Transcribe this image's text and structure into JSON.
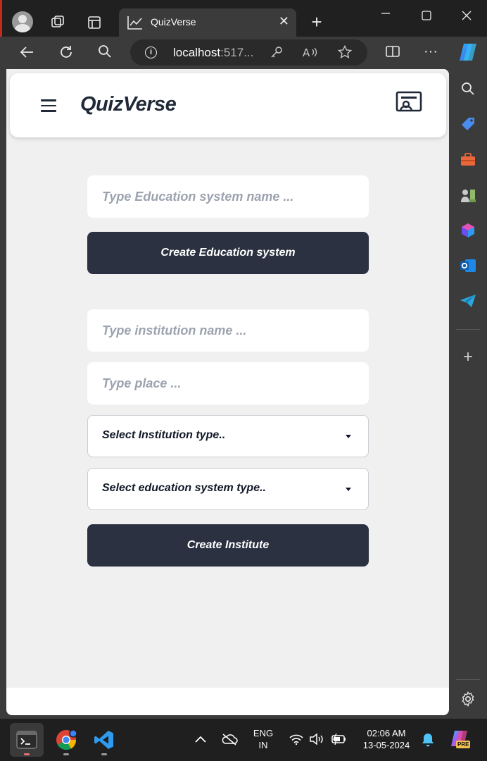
{
  "browser": {
    "tab_title": "QuizVerse",
    "url_host": "localhost",
    "url_rest": ":517...",
    "tab_close": "✕"
  },
  "app": {
    "brand": "QuizVerse"
  },
  "education_form": {
    "name_placeholder": "Type Education system name ...",
    "create_button": "Create Education system"
  },
  "institute_form": {
    "name_placeholder": "Type institution name ...",
    "place_placeholder": "Type place ...",
    "institution_type_select": "Select Institution type..",
    "education_system_select": "Select education system type..",
    "create_button": "Create Institute"
  },
  "taskbar": {
    "language_line1": "ENG",
    "language_line2": "IN",
    "time": "02:06 AM",
    "date": "13-05-2024",
    "copilot_badge": "PRE"
  },
  "colors": {
    "primary_button": "#2b3140",
    "page_background": "#f0f0f0",
    "brand_text": "#1f2937"
  }
}
